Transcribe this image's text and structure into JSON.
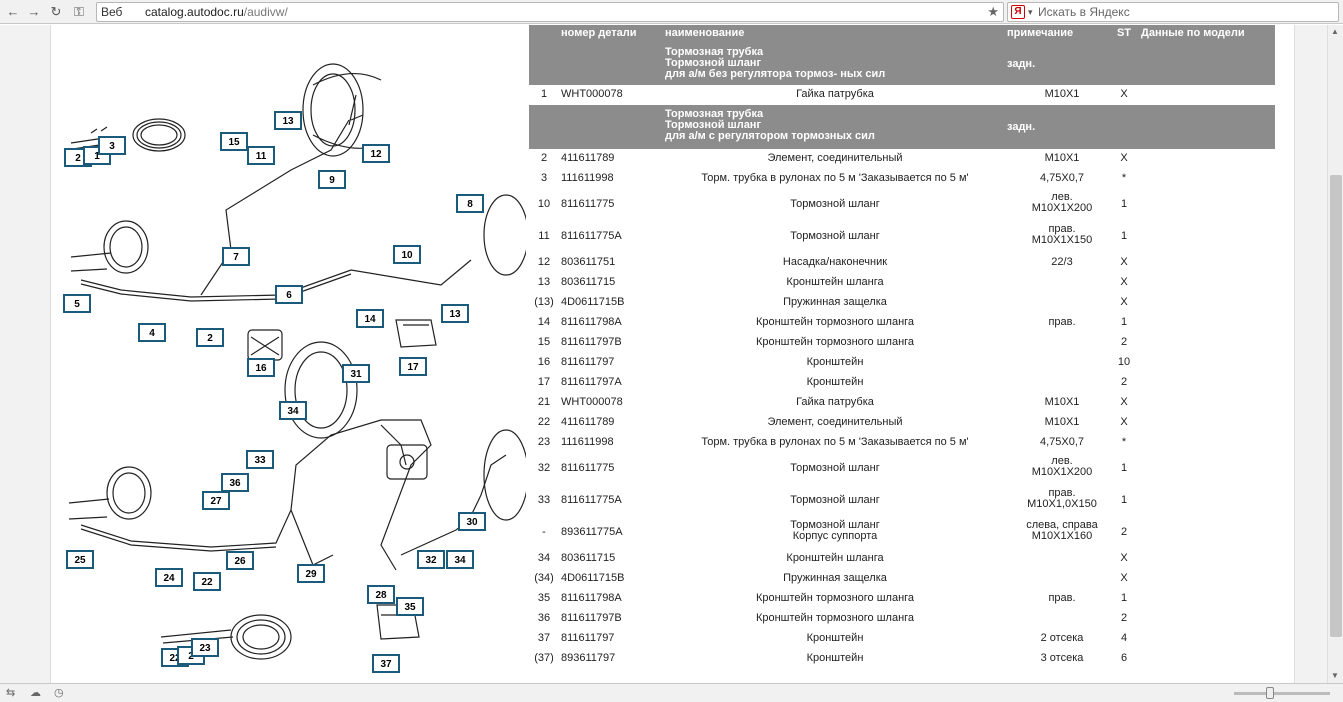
{
  "browser": {
    "proto_label": "Веб",
    "url_host": "catalog.autodoc.ru",
    "url_path": "/audivw/",
    "search_placeholder": "Искать в Яндекс",
    "search_logo": "Я"
  },
  "diagram": {
    "callouts": [
      "2",
      "1",
      "3",
      "13",
      "15",
      "11",
      "12",
      "9",
      "8",
      "7",
      "10",
      "5",
      "4",
      "6",
      "2",
      "14",
      "13",
      "16",
      "17",
      "31",
      "34",
      "33",
      "36",
      "27",
      "25",
      "24",
      "22",
      "26",
      "29",
      "28",
      "32",
      "34",
      "30",
      "35",
      "22",
      "2",
      "23",
      "37"
    ]
  },
  "table": {
    "columns": {
      "num": "",
      "part": "номер детали",
      "name": "наименование",
      "note": "примечание",
      "st": "ST",
      "model": "Данные по модели"
    },
    "group1": {
      "lines": [
        "Тормозная трубка",
        "Тормозной шланг",
        "для а/м  без регулятора тормоз- ных сил"
      ],
      "note": "задн."
    },
    "group1_rows": [
      {
        "num": "1",
        "part": "WHT000078",
        "name": "Гайка патрубка",
        "note": "M10X1",
        "st": "X"
      }
    ],
    "group2": {
      "lines": [
        "Тормозная трубка",
        "Тормозной шланг",
        "для а/м  с регулятором тормозных сил"
      ],
      "note": "задн."
    },
    "rows": [
      {
        "num": "2",
        "part": "411611789",
        "name": "Элемент, соединительный",
        "note": "M10X1",
        "st": "X"
      },
      {
        "num": "3",
        "part": "111611998",
        "name": "Торм. трубка в рулонах по 5 м 'Заказывается по 5 м'",
        "note": "4,75X0,7",
        "st": "*"
      },
      {
        "num": "10",
        "part": "811611775",
        "name": "Тормозной шланг",
        "note": "лев.",
        "note2": "M10X1X200",
        "st": "1"
      },
      {
        "num": "11",
        "part": "811611775A",
        "name": "Тормозной шланг",
        "note": "прав.",
        "note2": "M10X1X150",
        "st": "1"
      },
      {
        "num": "12",
        "part": "803611751",
        "name": "Насадка/наконечник",
        "note": "22/3",
        "st": "X"
      },
      {
        "num": "13",
        "part": "803611715",
        "name": "Кронштейн шланга",
        "note": "",
        "st": "X"
      },
      {
        "num": "(13)",
        "part": "4D0611715B",
        "name": "Пружинная защелка",
        "note": "",
        "st": "X"
      },
      {
        "num": "14",
        "part": "811611798A",
        "name": "Кронштейн тормозного шланга",
        "note": "прав.",
        "st": "1"
      },
      {
        "num": "15",
        "part": "811611797B",
        "name": "Кронштейн тормозного шланга",
        "note": "",
        "st": "2"
      },
      {
        "num": "16",
        "part": "811611797",
        "name": "Кронштейн",
        "note": "",
        "st": "10"
      },
      {
        "num": "17",
        "part": "811611797A",
        "name": "Кронштейн",
        "note": "",
        "st": "2"
      },
      {
        "num": "21",
        "part": "WHT000078",
        "name": "Гайка патрубка",
        "note": "M10X1",
        "st": "X"
      },
      {
        "num": "22",
        "part": "411611789",
        "name": "Элемент, соединительный",
        "note": "M10X1",
        "st": "X"
      },
      {
        "num": "23",
        "part": "111611998",
        "name": "Торм. трубка в рулонах по 5 м 'Заказывается по 5 м'",
        "note": "4,75X0,7",
        "st": "*"
      },
      {
        "num": "32",
        "part": "811611775",
        "name": "Тормозной шланг",
        "note": "лев.",
        "note2": "M10X1X200",
        "st": "1"
      },
      {
        "num": "33",
        "part": "811611775A",
        "name": "Тормозной шланг",
        "note": "прав.",
        "note2": "M10X1,0X150",
        "st": "1"
      },
      {
        "num": "-",
        "part": "893611775A",
        "name": "Тормозной шланг",
        "name2": "Корпус суппорта",
        "note": "слева, справа",
        "note2": "M10X1X160",
        "st": "2"
      },
      {
        "num": "34",
        "part": "803611715",
        "name": "Кронштейн шланга",
        "note": "",
        "st": "X"
      },
      {
        "num": "(34)",
        "part": "4D0611715B",
        "name": "Пружинная защелка",
        "note": "",
        "st": "X"
      },
      {
        "num": "35",
        "part": "811611798A",
        "name": "Кронштейн тормозного шланга",
        "note": "прав.",
        "st": "1"
      },
      {
        "num": "36",
        "part": "811611797B",
        "name": "Кронштейн тормозного шланга",
        "note": "",
        "st": "2"
      },
      {
        "num": "37",
        "part": "811611797",
        "name": "Кронштейн",
        "note": "2 отсека",
        "st": "4"
      },
      {
        "num": "(37)",
        "part": "893611797",
        "name": "Кронштейн",
        "note": "3 отсека",
        "st": "6"
      }
    ]
  }
}
